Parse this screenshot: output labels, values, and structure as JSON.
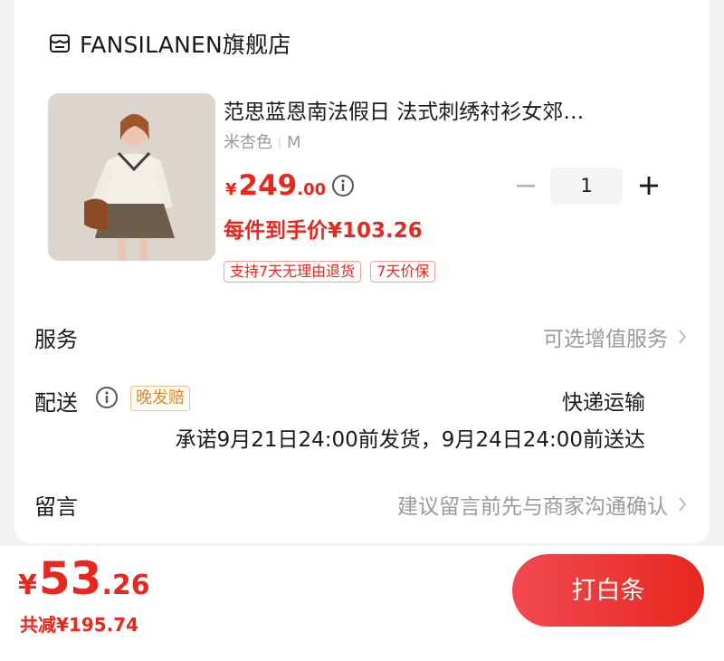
{
  "shop": {
    "name": "FANSILANEN旗舰店",
    "icon": "shop-icon"
  },
  "product": {
    "title": "范思蓝恩南法假日 法式刺绣衬衫女郊…",
    "spec_color": "米杏色",
    "spec_size": "M",
    "price_symbol": "¥",
    "price_int": "249",
    "price_dec": ".00",
    "quantity": "1",
    "hand_price": "每件到手价¥103.26",
    "tags": [
      "支持7天无理由退货",
      "7天价保"
    ]
  },
  "service": {
    "label": "服务",
    "value": "可选增值服务"
  },
  "delivery": {
    "label": "配送",
    "late_tag": "晚发赔",
    "method": "快递运输",
    "promise": "承诺9月21日24:00前发货，9月24日24:00前送达"
  },
  "message": {
    "label": "留言",
    "placeholder": "建议留言前先与商家沟通确认"
  },
  "footer": {
    "total_symbol": "¥",
    "total_int": "53",
    "total_dec": ".26",
    "saved": "共减¥195.74",
    "pay_label": "打白条"
  },
  "colors": {
    "accent": "#e8271f",
    "tag_orange": "#d98b2b",
    "muted": "#9a9a9a"
  }
}
